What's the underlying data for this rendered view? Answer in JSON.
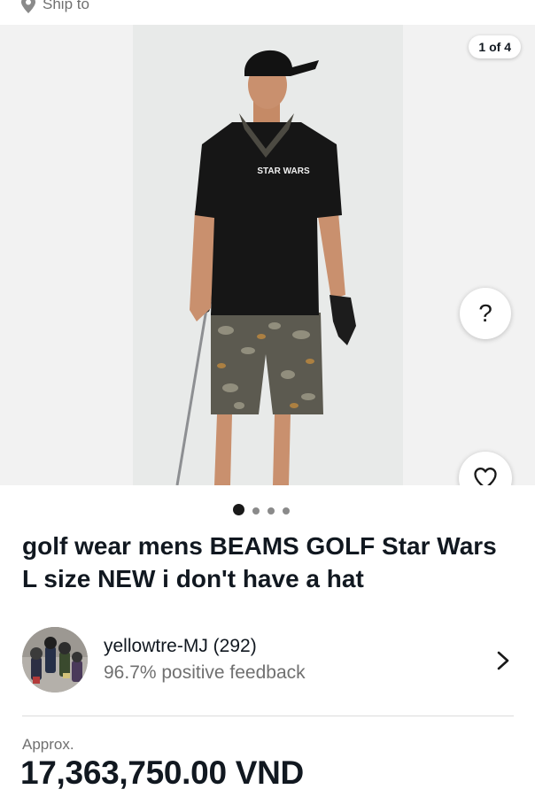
{
  "ship_bar": {
    "label": "Ship to",
    "icon": "location-pin-icon"
  },
  "gallery": {
    "counter": "1 of 4",
    "help_label": "?",
    "favorite_icon": "heart-icon",
    "photo_text": "STAR WARS",
    "dots": {
      "total": 4,
      "active": 1
    }
  },
  "listing": {
    "title": "golf wear mens BEAMS GOLF Star Wars L size NEW i don't have a hat"
  },
  "seller": {
    "name": "yellowtre-MJ (292)",
    "feedback": "96.7% positive feedback",
    "chevron_icon": "chevron-right-icon"
  },
  "price": {
    "approx_label": "Approx.",
    "value": "17,363,750.00 VND"
  },
  "colors": {
    "text_primary": "#111820",
    "text_secondary": "#707070",
    "divider": "#dcdcdc",
    "gallery_bg": "#f2f2f2"
  }
}
